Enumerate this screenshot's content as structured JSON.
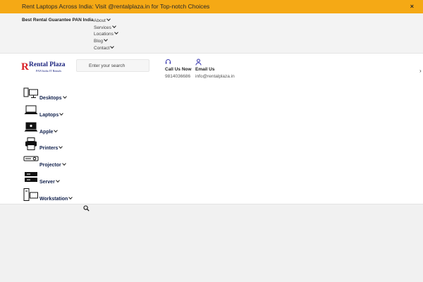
{
  "announcement": {
    "prefix": "Rent Laptops Across India: Visit ",
    "site": "@rentalplaza.in",
    "suffix": " for Top-notch Choices",
    "close": "×"
  },
  "topbar": {
    "guarantee": "Best Rental Guarantee PAN India",
    "links": [
      {
        "label": "About"
      },
      {
        "label": "Services"
      },
      {
        "label": "Locations"
      },
      {
        "label": "Blog"
      },
      {
        "label": "Contact"
      }
    ]
  },
  "logo": {
    "mark": "R",
    "name": "Rental Plaza",
    "tagline": "PAN India IT Rentals"
  },
  "search": {
    "placeholder": "Enter your search"
  },
  "contact": {
    "call": {
      "label": "Call Us Now",
      "value": "9814036686",
      "icon": "headset-icon"
    },
    "email": {
      "label": "Email Us",
      "value": "info@rentalplaza.in",
      "icon": "user-icon"
    }
  },
  "categories": [
    {
      "label": "Desktops",
      "icon": "desktop-icon"
    },
    {
      "label": "Laptops",
      "icon": "laptop-icon"
    },
    {
      "label": "Apple",
      "icon": "apple-laptop-icon"
    },
    {
      "label": "Printers",
      "icon": "printer-icon"
    },
    {
      "label": "Projector",
      "icon": "projector-icon"
    },
    {
      "label": "Server",
      "icon": "server-icon"
    },
    {
      "label": "Workstation",
      "icon": "workstation-icon"
    }
  ],
  "colors": {
    "announcement_bg": "#f5a915",
    "brand_red": "#d91f26",
    "brand_navy": "#1a237e",
    "category_text": "#0f1f4b",
    "contact_icon": "#3b3bb0"
  }
}
